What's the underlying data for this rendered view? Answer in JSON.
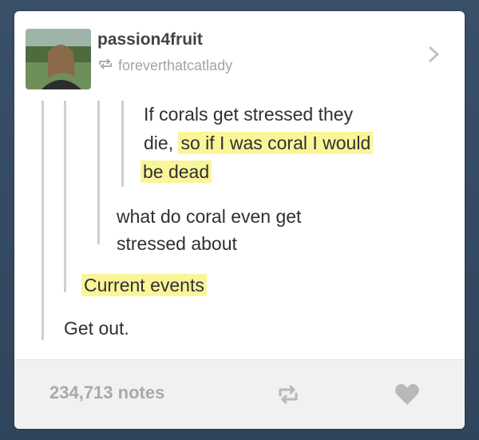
{
  "post": {
    "author": "passion4fruit",
    "reblogged_from": "foreverthatcatlady",
    "quote_1": {
      "line1": "If corals get stressed they",
      "line2_plain": "die,",
      "line2_highlight": "so if I was coral I would",
      "line3_highlight": "be dead"
    },
    "quote_2": {
      "line1": "what do coral even get",
      "line2": "stressed about"
    },
    "reply_1": "Current events",
    "reply_2": "Get out."
  },
  "footer": {
    "notes": "234,713 notes"
  },
  "colors": {
    "highlight": "#fbf59a",
    "text": "#303030",
    "muted": "#a9a9a9"
  },
  "icons": {
    "reblog": "reblog-icon",
    "heart": "heart-icon",
    "chevron": "chevron-right-icon"
  }
}
